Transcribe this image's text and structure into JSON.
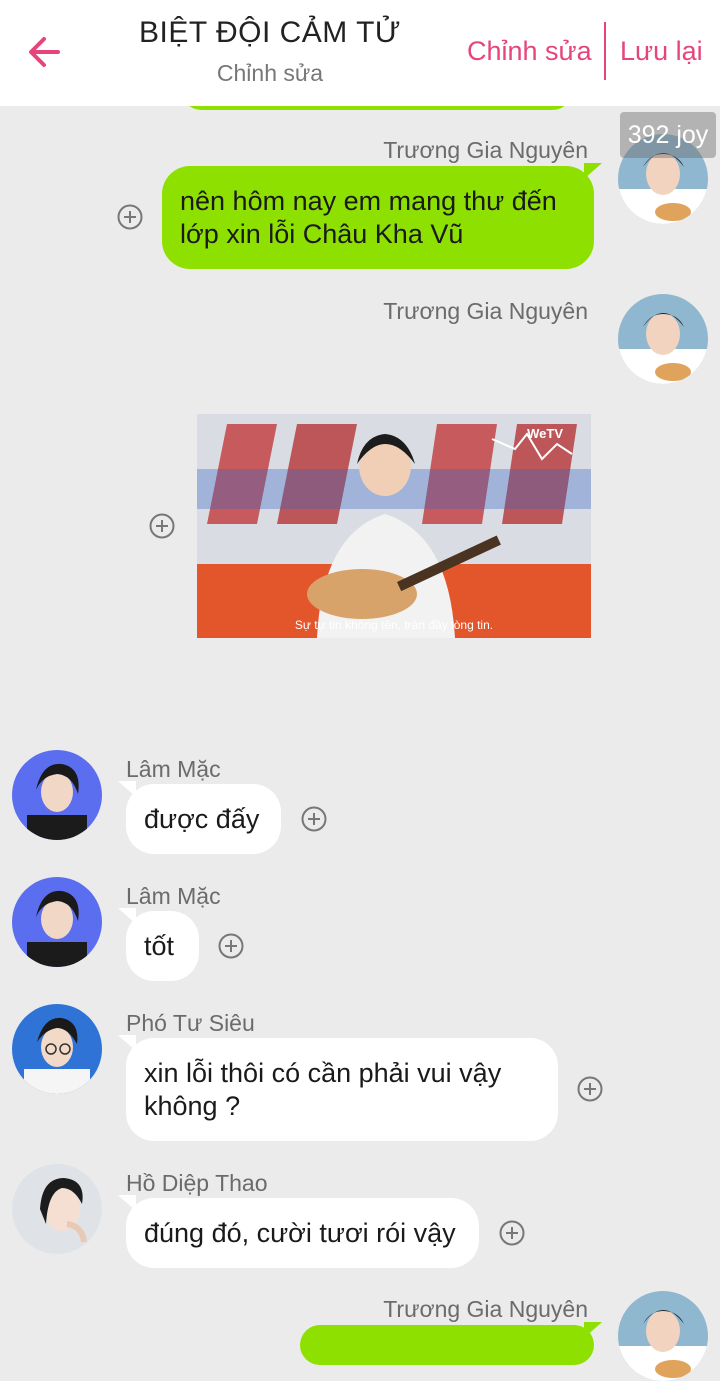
{
  "header": {
    "title": "BIỆT ĐỘI CẢM TỬ",
    "subtitle": "Chỉnh sửa",
    "edit_label": "Chỉnh sửa",
    "save_label": "Lưu lại",
    "back_icon": "arrow-left-icon",
    "accent": "#e6457c"
  },
  "badge": "392 joy",
  "messages": [
    {
      "sender": "Trương Gia Nguyên",
      "text": "nên hôm nay em mang thư đến lớp xin lỗi Châu Kha Vũ",
      "side": "right"
    },
    {
      "sender": "Trương Gia Nguyên",
      "image_caption": "Sự tự tin không tên, tràn đầy lòng tin.",
      "watermark": "WeTV",
      "side": "right"
    },
    {
      "sender": "Lâm Mặc",
      "text": "được đấy",
      "side": "left"
    },
    {
      "sender": "Lâm Mặc",
      "text": "tốt",
      "side": "left"
    },
    {
      "sender": "Phó Tư Siêu",
      "text": "xin lỗi thôi có cần phải vui vậy không ?",
      "side": "left"
    },
    {
      "sender": "Hồ Diệp Thao",
      "text": "đúng đó, cười tươi rói vậy",
      "side": "left"
    },
    {
      "sender": "Trương Gia Nguyên",
      "text": "",
      "side": "right"
    }
  ],
  "colors": {
    "sent_bubble": "#8ee000",
    "received_bubble": "#ffffff",
    "background": "#ebebeb"
  }
}
